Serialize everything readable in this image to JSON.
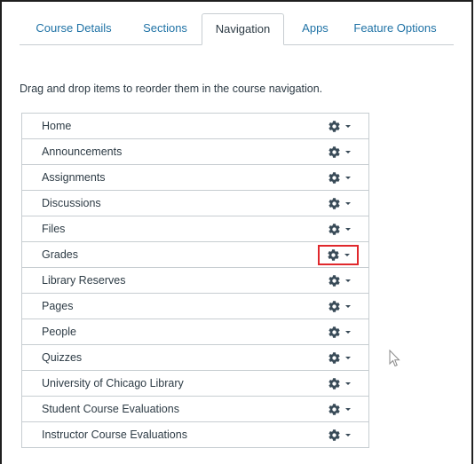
{
  "tabs": [
    {
      "label": "Course Details"
    },
    {
      "label": "Sections"
    },
    {
      "label": "Navigation"
    },
    {
      "label": "Apps"
    },
    {
      "label": "Feature Options"
    }
  ],
  "active_tab": "Navigation",
  "instructions": "Drag and drop items to reorder them in the course navigation.",
  "nav_items": [
    {
      "label": "Home"
    },
    {
      "label": "Announcements"
    },
    {
      "label": "Assignments"
    },
    {
      "label": "Discussions"
    },
    {
      "label": "Files"
    },
    {
      "label": "Grades"
    },
    {
      "label": "Library Reserves"
    },
    {
      "label": "Pages"
    },
    {
      "label": "People"
    },
    {
      "label": "Quizzes"
    },
    {
      "label": "University of Chicago Library"
    },
    {
      "label": "Student Course Evaluations"
    },
    {
      "label": "Instructor Course Evaluations"
    }
  ],
  "highlighted_item": "Grades",
  "icons": {
    "item_menu": "gear-icon",
    "dropdown": "caret-down-icon",
    "pointer": "mouse-cursor-icon"
  },
  "colors": {
    "link": "#2073a6",
    "text": "#2d3b45",
    "border": "#c7cdd1",
    "highlight": "#e0282c",
    "gear": "#394b58"
  }
}
